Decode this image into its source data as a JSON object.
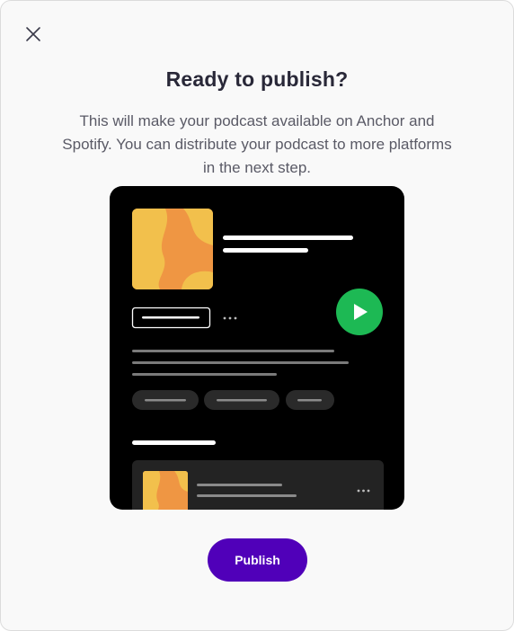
{
  "dialog": {
    "title": "Ready to publish?",
    "description": "This will make your podcast available on Anchor and Spotify. You can distribute your podcast to more platforms in the next step.",
    "publish_label": "Publish"
  },
  "icons": {
    "close": "close-icon",
    "play": "play-icon",
    "more": "more-icon"
  },
  "colors": {
    "modal_bg": "#f9f9f9",
    "title": "#292838",
    "text": "#5a5a66",
    "primary": "#5000b9",
    "play_green": "#1db954",
    "cover_orange": "#ef9643",
    "cover_yellow": "#f2c04c"
  }
}
